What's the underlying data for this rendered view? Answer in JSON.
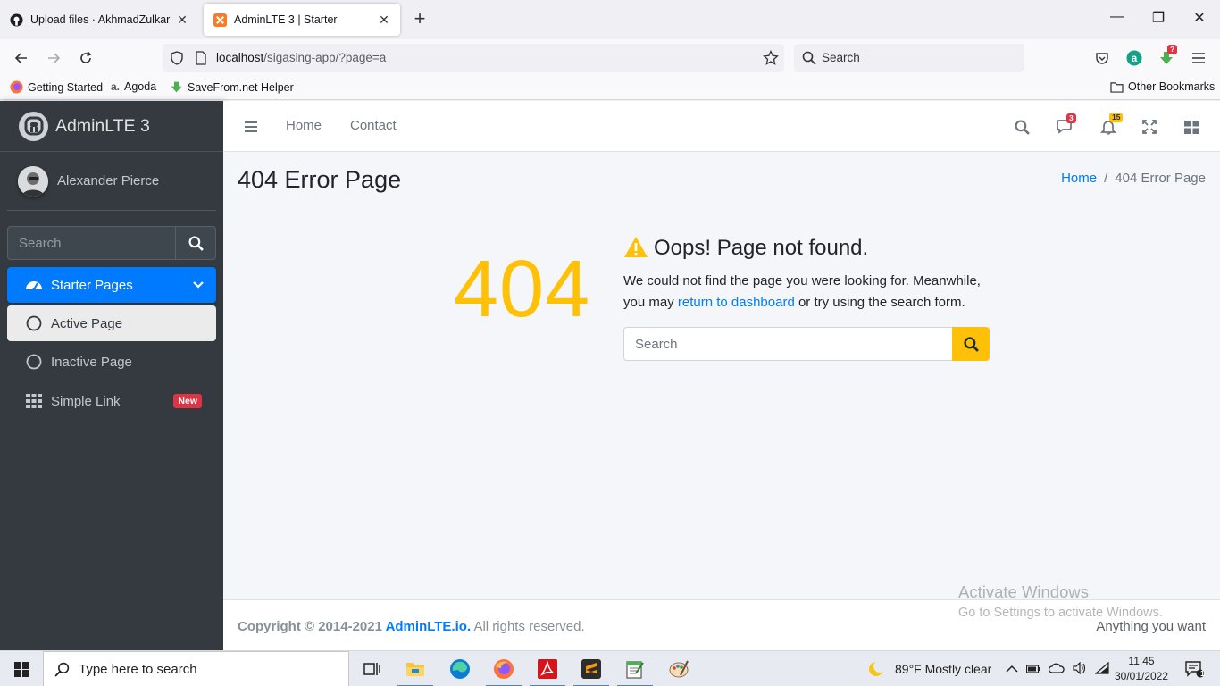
{
  "browser": {
    "tabs": [
      {
        "title": "Upload files · AkhmadZulkarnain"
      },
      {
        "title": "AdminLTE 3 | Starter"
      }
    ],
    "url": {
      "host": "localhost",
      "path": "/sigasing-app/?page=a"
    },
    "search_placeholder": "Search",
    "badges": {
      "extension_count": "?"
    },
    "bookmarks": [
      "Getting Started",
      "Agoda",
      "SaveFrom.net Helper"
    ],
    "other_bookmarks": "Other Bookmarks"
  },
  "sidebar": {
    "brand": "AdminLTE 3",
    "user": "Alexander Pierce",
    "search_placeholder": "Search",
    "menu": {
      "label": "Starter Pages"
    },
    "items": [
      {
        "label": "Active Page"
      },
      {
        "label": "Inactive Page"
      },
      {
        "label": "Simple Link",
        "badge": "New"
      }
    ]
  },
  "header": {
    "links": [
      "Home",
      "Contact"
    ],
    "messages_count": "3",
    "notifications_count": "15"
  },
  "content": {
    "title": "404 Error Page",
    "breadcrumb": {
      "home": "Home",
      "separator": "/",
      "current": "404 Error Page"
    },
    "error_code": "404",
    "error_title": "Oops! Page not found.",
    "error_text_1": "We could not find the page you were looking for. Meanwhile, you may ",
    "error_link": "return to dashboard",
    "error_text_2": " or try using the search form.",
    "search_placeholder": "Search"
  },
  "footer": {
    "copyright": "Copyright © 2014-2021 ",
    "brand": "AdminLTE.io.",
    "rights": " All rights reserved.",
    "right": "Anything you want"
  },
  "watermark": {
    "line1": "Activate Windows",
    "line2": "Go to Settings to activate Windows."
  },
  "taskbar": {
    "search_placeholder": "Type here to search",
    "weather": "89°F  Mostly clear",
    "time": "11:45",
    "date": "30/01/2022",
    "notification_count": "1"
  },
  "colors": {
    "primary": "#007bff",
    "warning": "#ffc107",
    "sidebar": "#343a40",
    "danger": "#dc3545"
  }
}
